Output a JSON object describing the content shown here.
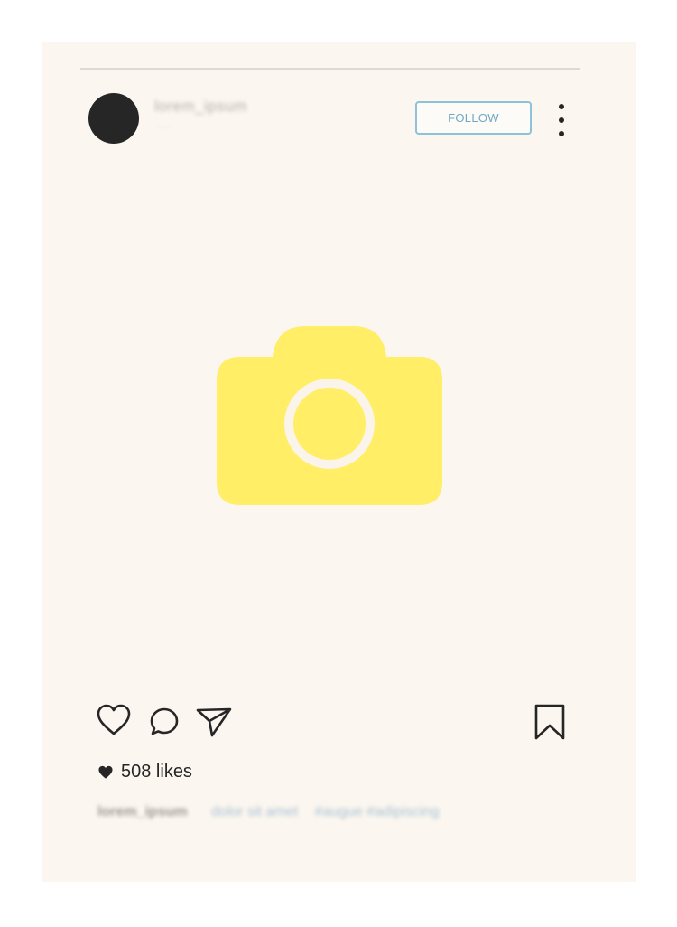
{
  "post": {
    "username": "lorem_ipsum",
    "sublabel": "· · ·",
    "follow_label": "FOLLOW",
    "more_icon": "more-vertical-icon",
    "media_icon": "camera-icon",
    "likes_count": "508 likes",
    "caption_user": "lorem_ipsum",
    "caption_text": "dolor sit amet",
    "caption_tags": "#augue #adipiscing"
  },
  "colors": {
    "card_background": "#fbf6ef",
    "camera_yellow": "#ffee66",
    "follow_border": "#8ec2d8",
    "icon_dark": "#262626"
  },
  "actions": {
    "like_icon": "heart-outline-icon",
    "comment_icon": "comment-icon",
    "share_icon": "send-icon",
    "save_icon": "bookmark-icon"
  }
}
